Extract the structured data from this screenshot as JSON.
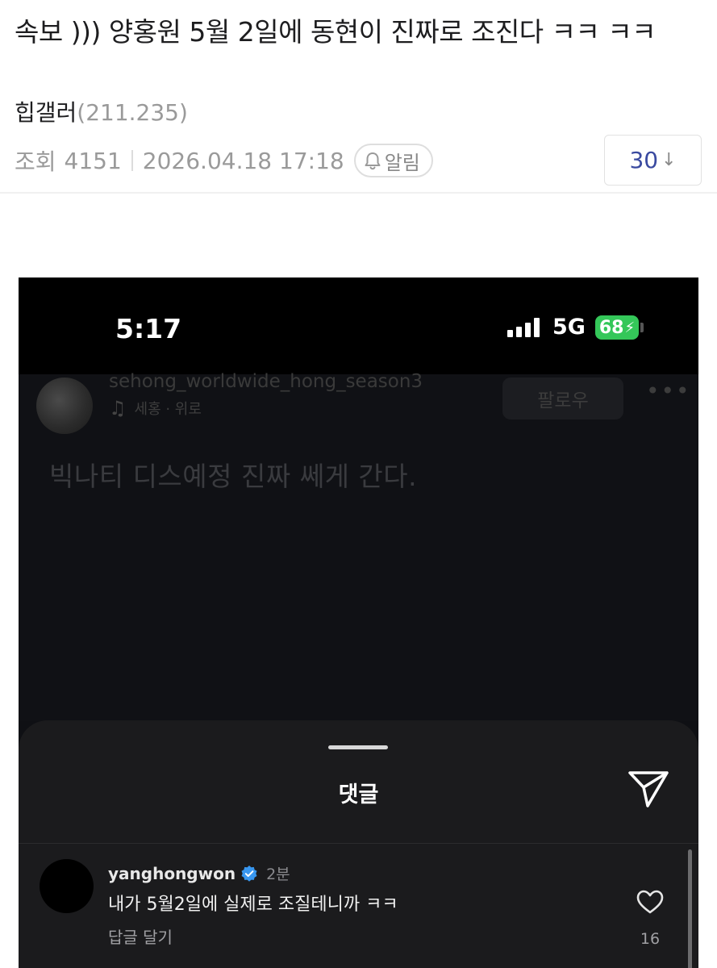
{
  "post": {
    "title": "속보 ))) 양홍원 5월 2일에 동현이 진짜로 조진다 ㅋㅋ ㅋㅋ",
    "author": "힙갤러",
    "author_ip": "(211.235)",
    "views_label": "조회",
    "views": "4151",
    "datetime": "2026.04.18 17:18",
    "alarm_label": "알림",
    "comment_count": "30",
    "comment_arrow": "↓"
  },
  "screenshot": {
    "status": {
      "time": "5:17",
      "network": "5G",
      "battery": "68"
    },
    "profile": {
      "username": "sehong_worldwide_hong_season3",
      "music": "세홍 · 위로",
      "follow_label": "팔로우"
    },
    "caption": "빅나티 디스예정 진짜 쎄게 간다.",
    "comments_sheet": {
      "title": "댓글",
      "comments": [
        {
          "user": "yanghongwon",
          "time": "2분",
          "text": "내가 5월2일에 실제로 조질테니까 ㅋㅋ",
          "reply_label": "답글 달기",
          "likes": "16"
        }
      ]
    }
  },
  "colors": {
    "accent": "#3a4aa0",
    "battery": "#34c759",
    "verified": "#3897f0"
  }
}
